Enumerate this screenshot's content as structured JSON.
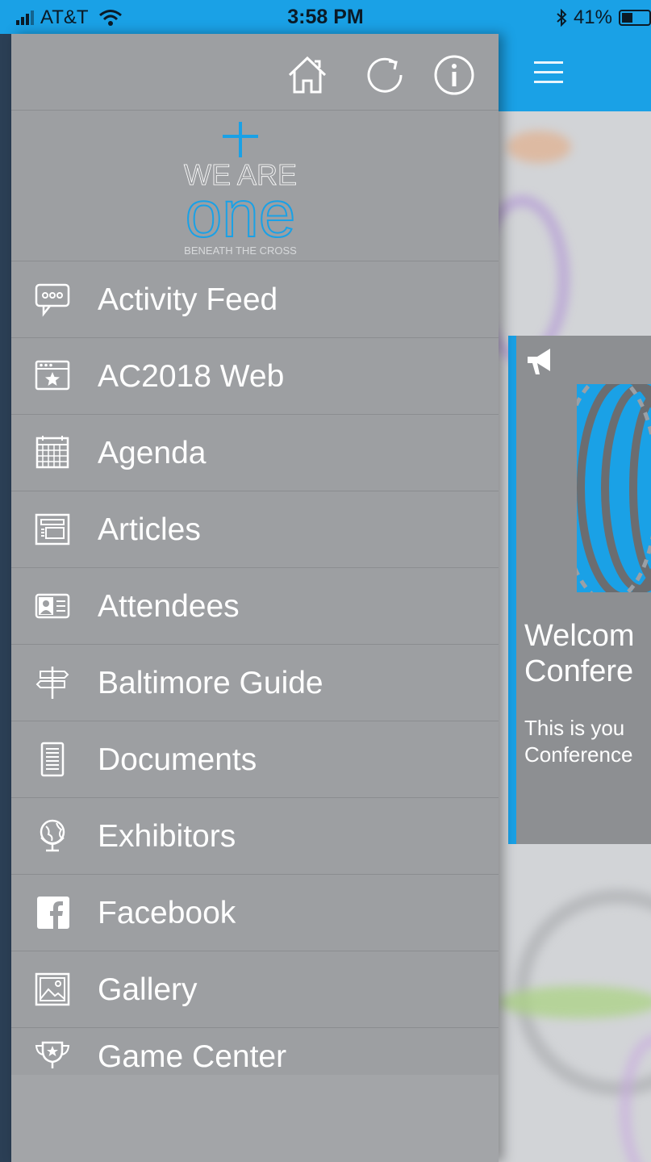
{
  "status_bar": {
    "carrier": "AT&T",
    "time": "3:58 PM",
    "battery": "41%",
    "battery_level": 0.41
  },
  "drawer": {
    "top_icons": [
      "home-icon",
      "refresh-icon",
      "info-icon"
    ],
    "logo": {
      "line1": "WE ARE",
      "line2": "one",
      "line3": "BENEATH THE CROSS"
    },
    "items": [
      {
        "label": "Activity Feed",
        "icon": "chat-bubble-icon"
      },
      {
        "label": "AC2018 Web",
        "icon": "web-star-icon"
      },
      {
        "label": "Agenda",
        "icon": "calendar-icon"
      },
      {
        "label": "Articles",
        "icon": "article-icon"
      },
      {
        "label": "Attendees",
        "icon": "id-card-icon"
      },
      {
        "label": "Baltimore Guide",
        "icon": "signpost-icon"
      },
      {
        "label": "Documents",
        "icon": "document-icon"
      },
      {
        "label": "Exhibitors",
        "icon": "globe-icon"
      },
      {
        "label": "Facebook",
        "icon": "facebook-icon"
      },
      {
        "label": "Gallery",
        "icon": "image-icon"
      },
      {
        "label": "Game Center",
        "icon": "trophy-icon"
      }
    ]
  },
  "card": {
    "title_line1": "Welcom",
    "title_line2": "Confere",
    "body_line1": "This is you",
    "body_line2": "Conference"
  },
  "colors": {
    "accent": "#1aa1e6",
    "drawer_bg": "#9d9fa2",
    "card_bg": "#8d8f92"
  }
}
